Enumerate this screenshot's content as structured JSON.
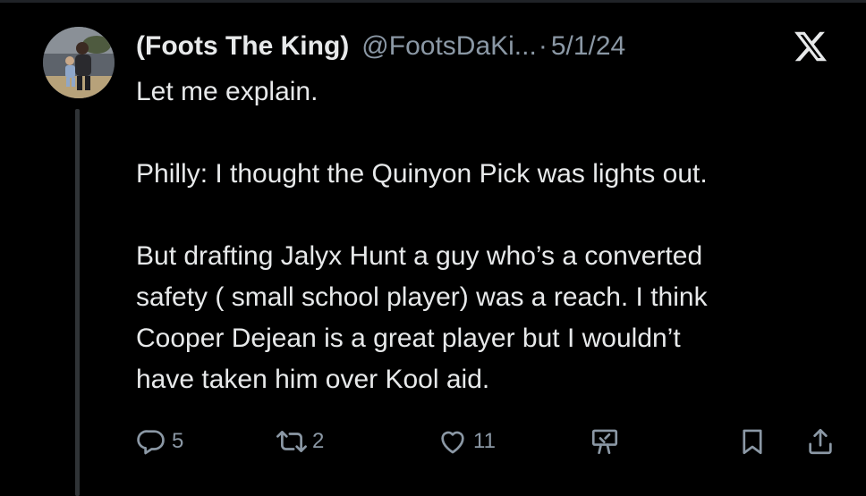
{
  "tweet": {
    "display_name": "(Foots The King)",
    "handle": "@FootsDaKi...",
    "separator": "·",
    "date": "5/1/24",
    "body": [
      "Let me explain.",
      "Philly: I thought the Quinyon Pick was lights out.",
      "But drafting Jalyx Hunt a guy who’s a converted",
      "safety ( small school player) was a reach. I think",
      "Cooper Dejean is a great player but I wouldn’t",
      "have taken him over Kool aid."
    ]
  },
  "actions": {
    "reply": {
      "icon": "reply-icon",
      "count": "5"
    },
    "retweet": {
      "icon": "retweet-icon",
      "count": "2"
    },
    "like": {
      "icon": "heart-icon",
      "count": "11"
    },
    "grok": {
      "icon": "grok-icon"
    },
    "bookmark": {
      "icon": "bookmark-icon"
    },
    "share": {
      "icon": "share-icon"
    }
  },
  "brand": {
    "logo": "x-logo-icon"
  },
  "colors": {
    "background": "#000000",
    "text": "#e7e9ea",
    "muted": "#8b98a5",
    "thread_line": "#2f3336"
  }
}
